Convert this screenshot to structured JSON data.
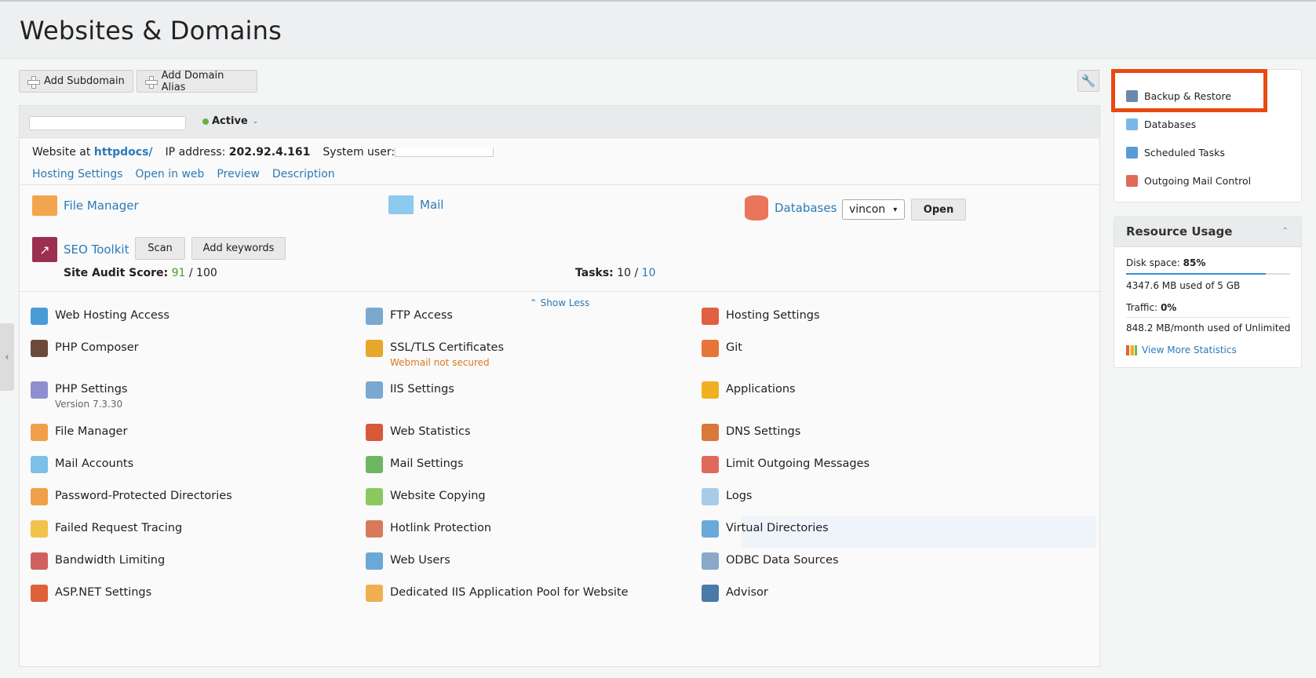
{
  "page": {
    "title": "Websites & Domains"
  },
  "toolbar": {
    "add_subdomain": "Add Subdomain",
    "add_alias": "Add Domain Alias"
  },
  "domain": {
    "status": "Active",
    "website_at_label": "Website at",
    "website_at_value": "httpdocs/",
    "ip_label": "IP address:",
    "ip_value": "202.92.4.161",
    "system_user_label": "System user:",
    "links": [
      "Hosting Settings",
      "Open in web",
      "Preview",
      "Description"
    ]
  },
  "quick": {
    "file_manager": "File Manager",
    "mail": "Mail",
    "databases": "Databases",
    "db_select": "vincon",
    "open": "Open"
  },
  "seo": {
    "name": "SEO Toolkit",
    "scan": "Scan",
    "add_keywords": "Add keywords",
    "audit_label": "Site Audit Score:",
    "audit_value": "91",
    "audit_max": "/ 100",
    "tasks_label": "Tasks:",
    "tasks_value": "10 /",
    "tasks_total": "10"
  },
  "show_less": "Show Less",
  "tools": [
    [
      {
        "label": "Web Hosting Access",
        "icon": "globe-icon",
        "color": "#4a9ad8"
      },
      {
        "label": "PHP Composer",
        "icon": "composer-icon",
        "color": "#6b4a3a"
      },
      {
        "label": "PHP Settings",
        "sub": "Version 7.3.30",
        "icon": "php-icon",
        "color": "#8f8fd0"
      },
      {
        "label": "File Manager",
        "icon": "folder-icon",
        "color": "#f0a04a"
      },
      {
        "label": "Mail Accounts",
        "icon": "mail-icon",
        "color": "#7cc0e8"
      },
      {
        "label": "Password-Protected Directories",
        "icon": "locked-folder-icon",
        "color": "#f0a04a"
      },
      {
        "label": "Failed Request Tracing",
        "icon": "tracing-icon",
        "color": "#f2c24a"
      },
      {
        "label": "Bandwidth Limiting",
        "icon": "bandwidth-icon",
        "color": "#d06060"
      },
      {
        "label": "ASP.NET Settings",
        "icon": "aspnet-icon",
        "color": "#e0603a"
      }
    ],
    [
      {
        "label": "FTP Access",
        "icon": "ftp-icon",
        "color": "#7aa8d0"
      },
      {
        "label": "SSL/TLS Certificates",
        "warn": "Webmail not secured",
        "icon": "lock-icon",
        "color": "#e8a62a"
      },
      {
        "label": "IIS Settings",
        "icon": "iis-icon",
        "color": "#7aa8d0"
      },
      {
        "label": "Web Statistics",
        "icon": "statistics-icon",
        "color": "#d8583a"
      },
      {
        "label": "Mail Settings",
        "icon": "mail-settings-icon",
        "color": "#6cb860"
      },
      {
        "label": "Website Copying",
        "icon": "copy-icon",
        "color": "#8cc860"
      },
      {
        "label": "Hotlink Protection",
        "icon": "hotlink-icon",
        "color": "#d87a5a"
      },
      {
        "label": "Web Users",
        "icon": "web-users-icon",
        "color": "#6aa8d8"
      },
      {
        "label": "Dedicated IIS Application Pool for Website",
        "icon": "app-pool-icon",
        "color": "#f0b050"
      }
    ],
    [
      {
        "label": "Hosting Settings",
        "icon": "hosting-settings-icon",
        "color": "#e06040"
      },
      {
        "label": "Git",
        "icon": "git-icon",
        "color": "#e8743a"
      },
      {
        "label": "Applications",
        "icon": "gear-icon",
        "color": "#f0b020"
      },
      {
        "label": "DNS Settings",
        "icon": "dns-icon",
        "color": "#d8783a"
      },
      {
        "label": "Limit Outgoing Messages",
        "icon": "limit-mail-icon",
        "color": "#e06a5a"
      },
      {
        "label": "Logs",
        "icon": "logs-icon",
        "color": "#a8cce8"
      },
      {
        "label": "Virtual Directories",
        "icon": "virtual-dir-icon",
        "color": "#6aaad8"
      },
      {
        "label": "ODBC Data Sources",
        "icon": "odbc-icon",
        "color": "#8aa8c8"
      },
      {
        "label": "Advisor",
        "icon": "advisor-icon",
        "color": "#4a7aa8"
      }
    ]
  ],
  "sidebar": {
    "items": [
      {
        "label": "Backup & Restore",
        "icon": "backup-icon",
        "color": "#6a8aa8"
      },
      {
        "label": "Databases",
        "icon": "database-icon",
        "color": "#7ab8e8"
      },
      {
        "label": "Scheduled Tasks",
        "icon": "calendar-icon",
        "color": "#5a9ad8"
      },
      {
        "label": "Outgoing Mail Control",
        "icon": "mail-control-icon",
        "color": "#e06a5a"
      }
    ]
  },
  "resources": {
    "title": "Resource Usage",
    "disk_label": "Disk space:",
    "disk_pct": "85%",
    "disk_fraction": 0.85,
    "disk_used": "4347.6 MB used of 5 GB",
    "traffic_label": "Traffic:",
    "traffic_pct": "0%",
    "traffic_used": "848.2 MB/month used of Unlimited",
    "more_stats": "View More Statistics"
  },
  "colors": {
    "accent_link": "#2b7ab8",
    "highlight": "#e84a10",
    "status_active": "#6dae40"
  }
}
